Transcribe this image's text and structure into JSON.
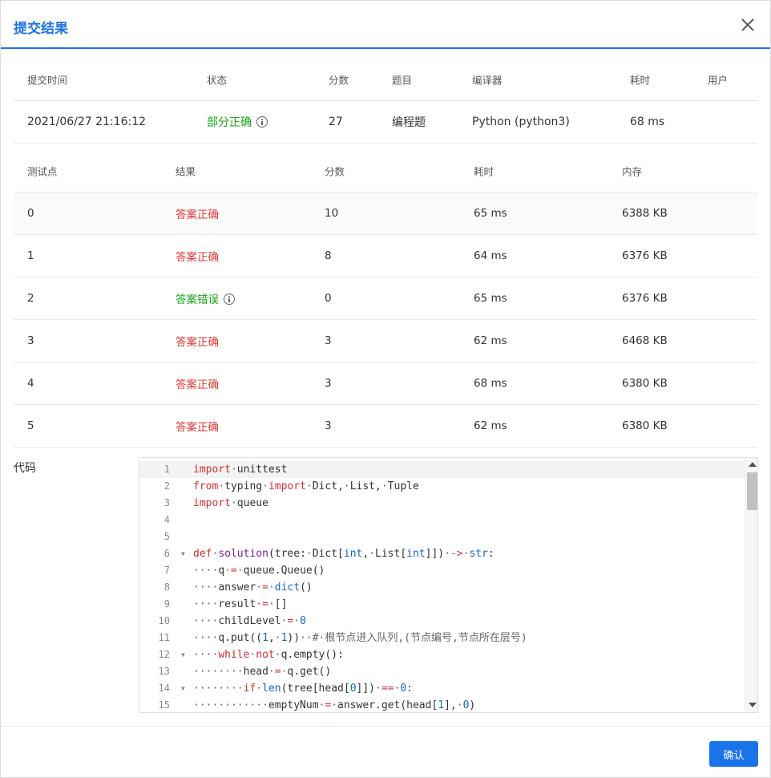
{
  "dialog": {
    "title": "提交结果",
    "confirm_label": "确认"
  },
  "summary": {
    "headers": [
      "提交时间",
      "状态",
      "分数",
      "题目",
      "编译器",
      "耗时",
      "用户"
    ],
    "row": {
      "time": "2021/06/27 21:16:12",
      "status": "部分正确",
      "score": "27",
      "problem": "编程题",
      "compiler": "Python (python3)",
      "elapsed": "68 ms",
      "user": ""
    }
  },
  "cases": {
    "headers": [
      "测试点",
      "结果",
      "分数",
      "耗时",
      "内存"
    ],
    "rows": [
      {
        "id": "0",
        "result": "答案正确",
        "score": "10",
        "time": "65 ms",
        "memory": "6388 KB"
      },
      {
        "id": "1",
        "result": "答案正确",
        "score": "8",
        "time": "64 ms",
        "memory": "6376 KB"
      },
      {
        "id": "2",
        "result": "答案错误",
        "score": "0",
        "time": "65 ms",
        "memory": "6376 KB"
      },
      {
        "id": "3",
        "result": "答案正确",
        "score": "3",
        "time": "62 ms",
        "memory": "6468 KB"
      },
      {
        "id": "4",
        "result": "答案正确",
        "score": "3",
        "time": "68 ms",
        "memory": "6380 KB"
      },
      {
        "id": "5",
        "result": "答案正确",
        "score": "3",
        "time": "62 ms",
        "memory": "6380 KB"
      }
    ]
  },
  "code": {
    "label": "代码",
    "line_numbers": [
      "1",
      "2",
      "3",
      "4",
      "5",
      "6",
      "7",
      "8",
      "9",
      "10",
      "11",
      "12",
      "13",
      "14",
      "15"
    ]
  },
  "colors": {
    "accent": "#1a73e8",
    "success": "#e53935",
    "fail": "#19a519"
  }
}
